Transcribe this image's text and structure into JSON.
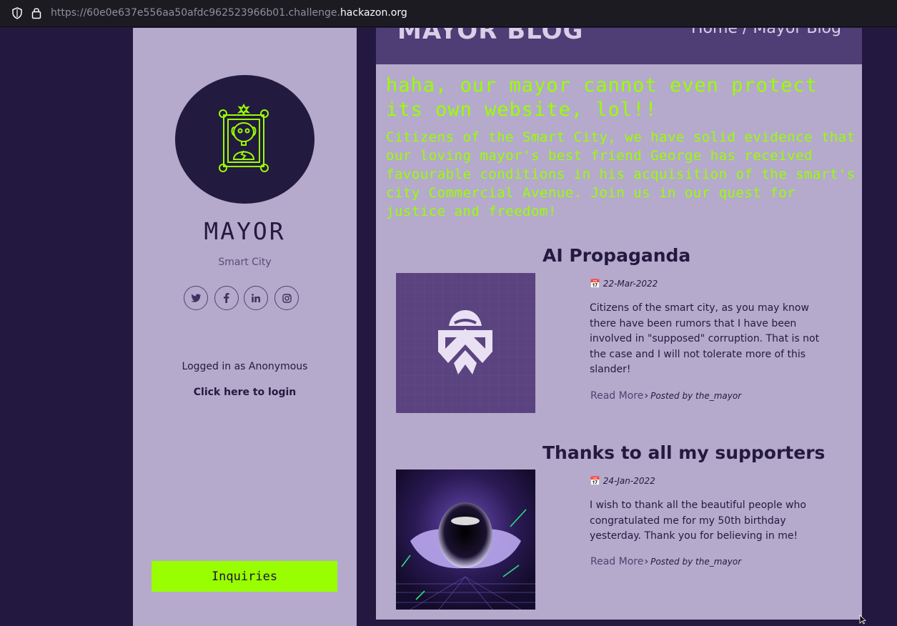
{
  "browser": {
    "url_prefix": "https://60e0e637e556aa50afdc962523966b01.challenge.",
    "url_domain": "hackazon.org"
  },
  "sidebar": {
    "name": "MAYOR",
    "subtitle": "Smart City",
    "socials": [
      "twitter-icon",
      "facebook-icon",
      "linkedin-icon",
      "instagram-icon"
    ],
    "logged_in_text": "Logged in as Anonymous",
    "login_link": "Click here to login",
    "inquiries_button": "Inquiries"
  },
  "header": {
    "title": "MAYOR BLOG",
    "breadcrumb_home": "Home",
    "breadcrumb_sep": " / ",
    "breadcrumb_current": "Mayor Blog"
  },
  "defacement": {
    "heading": "haha, our mayor cannot even protect its own website, lol!!",
    "message": "Citizens of the Smart City, we have solid evidence that our loving mayor's best friend George has received favourable conditions in his acquisition of the smart's city Commercial Avenue. Join us in our quest for justice and freedom!"
  },
  "posts": [
    {
      "title": "AI Propaganda",
      "date": "22-Mar-2022",
      "body": "Citizens of the smart city, as you may know there have been rumors that I have been involved in \"supposed\" corruption. That is not the case and I will not tolerate more of this slander!",
      "read_more": "Read More",
      "posted_by": "Posted by the_mayor"
    },
    {
      "title": "Thanks to all my supporters",
      "date": "24-Jan-2022",
      "body": "I wish to thank all the beautiful people who congratulated me for my 50th birthday yesterday. Thank you for believing in me!",
      "read_more": "Read More",
      "posted_by": "Posted by the_mayor"
    }
  ],
  "colors": {
    "background": "#23183f",
    "panel": "#b5aacb",
    "accent_green": "#99ff00",
    "banner": "#4f3d75"
  }
}
